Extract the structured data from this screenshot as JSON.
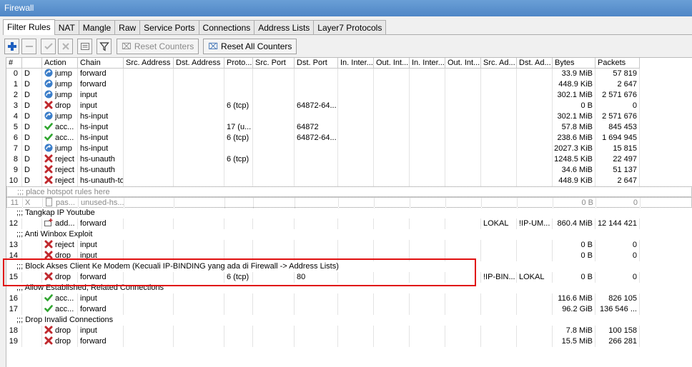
{
  "window": {
    "title": "Firewall"
  },
  "tabs": [
    "Filter Rules",
    "NAT",
    "Mangle",
    "Raw",
    "Service Ports",
    "Connections",
    "Address Lists",
    "Layer7 Protocols"
  ],
  "active_tab": 0,
  "toolbar": {
    "reset_counters": "Reset Counters",
    "reset_all_counters": "Reset All Counters"
  },
  "columns": [
    "#",
    "",
    "Action",
    "Chain",
    "Src. Address",
    "Dst. Address",
    "Proto...",
    "Src. Port",
    "Dst. Port",
    "In. Inter...",
    "Out. Int...",
    "In. Inter...",
    "Out. Int...",
    "Src. Ad...",
    "Dst. Ad...",
    "Bytes",
    "Packets"
  ],
  "rows": [
    {
      "type": "rule",
      "num": "0",
      "flag": "D",
      "action": "jump",
      "icon": "jump",
      "chain": "forward",
      "proto": "",
      "dport": "",
      "srcad": "",
      "dstad": "",
      "bytes": "33.9 MiB",
      "packets": "57 819"
    },
    {
      "type": "rule",
      "num": "1",
      "flag": "D",
      "action": "jump",
      "icon": "jump",
      "chain": "forward",
      "proto": "",
      "dport": "",
      "srcad": "",
      "dstad": "",
      "bytes": "448.9 KiB",
      "packets": "2 647"
    },
    {
      "type": "rule",
      "num": "2",
      "flag": "D",
      "action": "jump",
      "icon": "jump",
      "chain": "input",
      "proto": "",
      "dport": "",
      "srcad": "",
      "dstad": "",
      "bytes": "302.1 MiB",
      "packets": "2 571 676"
    },
    {
      "type": "rule",
      "num": "3",
      "flag": "D",
      "action": "drop",
      "icon": "drop",
      "chain": "input",
      "proto": "6 (tcp)",
      "dport": "64872-64...",
      "srcad": "",
      "dstad": "",
      "bytes": "0 B",
      "packets": "0"
    },
    {
      "type": "rule",
      "num": "4",
      "flag": "D",
      "action": "jump",
      "icon": "jump",
      "chain": "hs-input",
      "proto": "",
      "dport": "",
      "srcad": "",
      "dstad": "",
      "bytes": "302.1 MiB",
      "packets": "2 571 676"
    },
    {
      "type": "rule",
      "num": "5",
      "flag": "D",
      "action": "acc...",
      "icon": "accept",
      "chain": "hs-input",
      "proto": "17 (u...",
      "dport": "64872",
      "srcad": "",
      "dstad": "",
      "bytes": "57.8 MiB",
      "packets": "845 453"
    },
    {
      "type": "rule",
      "num": "6",
      "flag": "D",
      "action": "acc...",
      "icon": "accept",
      "chain": "hs-input",
      "proto": "6 (tcp)",
      "dport": "64872-64...",
      "srcad": "",
      "dstad": "",
      "bytes": "238.6 MiB",
      "packets": "1 694 945"
    },
    {
      "type": "rule",
      "num": "7",
      "flag": "D",
      "action": "jump",
      "icon": "jump",
      "chain": "hs-input",
      "proto": "",
      "dport": "",
      "srcad": "",
      "dstad": "",
      "bytes": "2027.3 KiB",
      "packets": "15 815"
    },
    {
      "type": "rule",
      "num": "8",
      "flag": "D",
      "action": "reject",
      "icon": "drop",
      "chain": "hs-unauth",
      "proto": "6 (tcp)",
      "dport": "",
      "srcad": "",
      "dstad": "",
      "bytes": "1248.5 KiB",
      "packets": "22 497"
    },
    {
      "type": "rule",
      "num": "9",
      "flag": "D",
      "action": "reject",
      "icon": "drop",
      "chain": "hs-unauth",
      "proto": "",
      "dport": "",
      "srcad": "",
      "dstad": "",
      "bytes": "34.6 MiB",
      "packets": "51 137"
    },
    {
      "type": "rule",
      "num": "10",
      "flag": "D",
      "action": "reject",
      "icon": "drop",
      "chain": "hs-unauth-to",
      "proto": "",
      "dport": "",
      "srcad": "",
      "dstad": "",
      "bytes": "448.9 KiB",
      "packets": "2 647"
    },
    {
      "type": "comment",
      "text": ";;; place hotspot rules here",
      "disabled": true
    },
    {
      "type": "rule",
      "num": "11",
      "flag": "X",
      "action": "pas...",
      "icon": "passthrough",
      "chain": "unused-hs...",
      "proto": "",
      "dport": "",
      "srcad": "",
      "dstad": "",
      "bytes": "0 B",
      "packets": "0",
      "disabled": true
    },
    {
      "type": "comment",
      "text": ";;; Tangkap IP Youtube"
    },
    {
      "type": "rule",
      "num": "12",
      "flag": "",
      "action": "add...",
      "icon": "add",
      "chain": "forward",
      "proto": "",
      "dport": "",
      "srcad": "LOKAL",
      "dstad": "!IP-UM...",
      "bytes": "860.4 MiB",
      "packets": "12 144 421"
    },
    {
      "type": "comment",
      "text": ";;; Anti Winbox Exploit"
    },
    {
      "type": "rule",
      "num": "13",
      "flag": "",
      "action": "reject",
      "icon": "drop",
      "chain": "input",
      "proto": "",
      "dport": "",
      "srcad": "",
      "dstad": "",
      "bytes": "0 B",
      "packets": "0"
    },
    {
      "type": "rule",
      "num": "14",
      "flag": "",
      "action": "drop",
      "icon": "drop",
      "chain": "input",
      "proto": "",
      "dport": "",
      "srcad": "",
      "dstad": "",
      "bytes": "0 B",
      "packets": "0"
    },
    {
      "type": "comment",
      "text": ";;; Block Akses Client Ke Modem (Kecuali IP-BINDING yang ada di Firewall -> Address Lists)"
    },
    {
      "type": "rule",
      "num": "15",
      "flag": "",
      "action": "drop",
      "icon": "drop",
      "chain": "forward",
      "proto": "6 (tcp)",
      "dport": "80",
      "srcad": "!IP-BIN...",
      "dstad": "LOKAL",
      "bytes": "0 B",
      "packets": "0"
    },
    {
      "type": "comment",
      "text": ";;; Allow Established, Related Connections"
    },
    {
      "type": "rule",
      "num": "16",
      "flag": "",
      "action": "acc...",
      "icon": "accept",
      "chain": "input",
      "proto": "",
      "dport": "",
      "srcad": "",
      "dstad": "",
      "bytes": "116.6 MiB",
      "packets": "826 105"
    },
    {
      "type": "rule",
      "num": "17",
      "flag": "",
      "action": "acc...",
      "icon": "accept",
      "chain": "forward",
      "proto": "",
      "dport": "",
      "srcad": "",
      "dstad": "",
      "bytes": "96.2 GiB",
      "packets": "136 546 ..."
    },
    {
      "type": "comment",
      "text": ";;; Drop Invalid Connections"
    },
    {
      "type": "rule",
      "num": "18",
      "flag": "",
      "action": "drop",
      "icon": "drop",
      "chain": "input",
      "proto": "",
      "dport": "",
      "srcad": "",
      "dstad": "",
      "bytes": "7.8 MiB",
      "packets": "100 158"
    },
    {
      "type": "rule",
      "num": "19",
      "flag": "",
      "action": "drop",
      "icon": "drop",
      "chain": "forward",
      "proto": "",
      "dport": "",
      "srcad": "",
      "dstad": "",
      "bytes": "15.5 MiB",
      "packets": "266 281"
    }
  ],
  "colors": {
    "highlight": "#e01010",
    "titlebar": "#5b8fcc",
    "drop": "#c0282d",
    "accept": "#2fa52f",
    "jump": "#3a7dc9"
  }
}
